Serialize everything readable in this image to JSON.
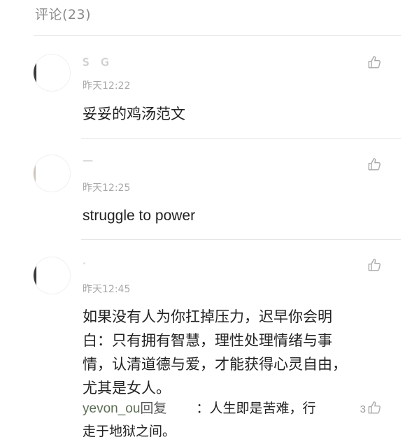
{
  "header": {
    "title": "评论(23)"
  },
  "comments": [
    {
      "username_obscured": "S      G",
      "time": "昨天12:22",
      "text": "妥妥的鸡汤范文"
    },
    {
      "username_obscured": "—",
      "time": "昨天12:25",
      "text": "struggle to power"
    },
    {
      "username_obscured": "·",
      "time": "昨天12:45",
      "text_lines": [
        "如果没有人为你扛掉压力，迟早你会明",
        "白：只有拥有智慧，理性处理情绪与事",
        "情，认清道德与爱，才能获得心灵自由，",
        "尤其是女人。"
      ],
      "reply": {
        "user": "yevon_ou",
        "verb": "回复",
        "target_and_colon": "：",
        "text_line1": "人生即是苦难，行",
        "text_line2": "走于地狱之间。",
        "likes": "3"
      }
    }
  ],
  "colors": {
    "header_text": "#8a8a8a",
    "timestamp": "#a8a8a8",
    "body_text": "#222222",
    "divider": "#e6e6e6",
    "reply_user": "#5b6e55",
    "like_icon": "#aaaaaa"
  },
  "icons": {
    "like": "thumbs-up-icon"
  }
}
